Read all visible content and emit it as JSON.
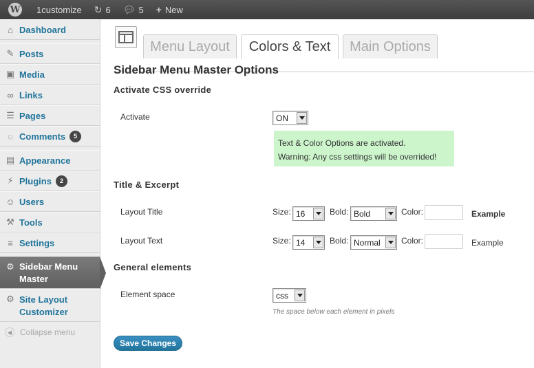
{
  "adminbar": {
    "wp_logo": "W",
    "site_name": "1customize",
    "updates_icon": "refresh-icon",
    "updates_count": "6",
    "comments_icon": "comment-icon",
    "comments_count": "5",
    "new_icon": "plus-icon",
    "new_label": "New"
  },
  "sidebar": {
    "items": [
      {
        "label": "Dashboard",
        "icon": "home-icon"
      },
      {
        "label": "Posts",
        "icon": "pin-icon"
      },
      {
        "label": "Media",
        "icon": "media-icon"
      },
      {
        "label": "Links",
        "icon": "link-icon"
      },
      {
        "label": "Pages",
        "icon": "pages-icon"
      },
      {
        "label": "Comments",
        "icon": "comments-icon",
        "badge": "5"
      },
      {
        "label": "Appearance",
        "icon": "appearance-icon"
      },
      {
        "label": "Plugins",
        "icon": "plugin-icon",
        "badge": "2"
      },
      {
        "label": "Users",
        "icon": "users-icon"
      },
      {
        "label": "Tools",
        "icon": "tools-icon"
      },
      {
        "label": "Settings",
        "icon": "settings-icon"
      },
      {
        "label": "Sidebar Menu Master",
        "icon": "gear-icon"
      },
      {
        "label": "Site Layout Customizer",
        "icon": "gear-icon"
      }
    ],
    "collapse_label": "Collapse menu"
  },
  "tabs": {
    "items": [
      "Menu Layout",
      "Colors & Text",
      "Main Options"
    ],
    "active": "Colors & Text"
  },
  "page": {
    "title": "Sidebar Menu Master Options",
    "activate_section": "Activate CSS override",
    "activate_label": "Activate",
    "activate_value": "ON",
    "notice_line1": "Text & Color Options are activated.",
    "notice_line2": "Warning: Any css settings will be overrided!",
    "title_section": "Title & Excerpt",
    "layout_title_label": "Layout Title",
    "layout_text_label": "Layout Text",
    "size_label": "Size:",
    "bold_label": "Bold:",
    "color_label": "Color:",
    "title_size": "16",
    "title_bold": "Bold",
    "text_size": "14",
    "text_bold": "Normal",
    "example_label": "Example",
    "general_section": "General elements",
    "element_space_label": "Element space",
    "element_space_value": "css",
    "element_space_hint": "The space below each element in pixels",
    "save_label": "Save Changes"
  }
}
